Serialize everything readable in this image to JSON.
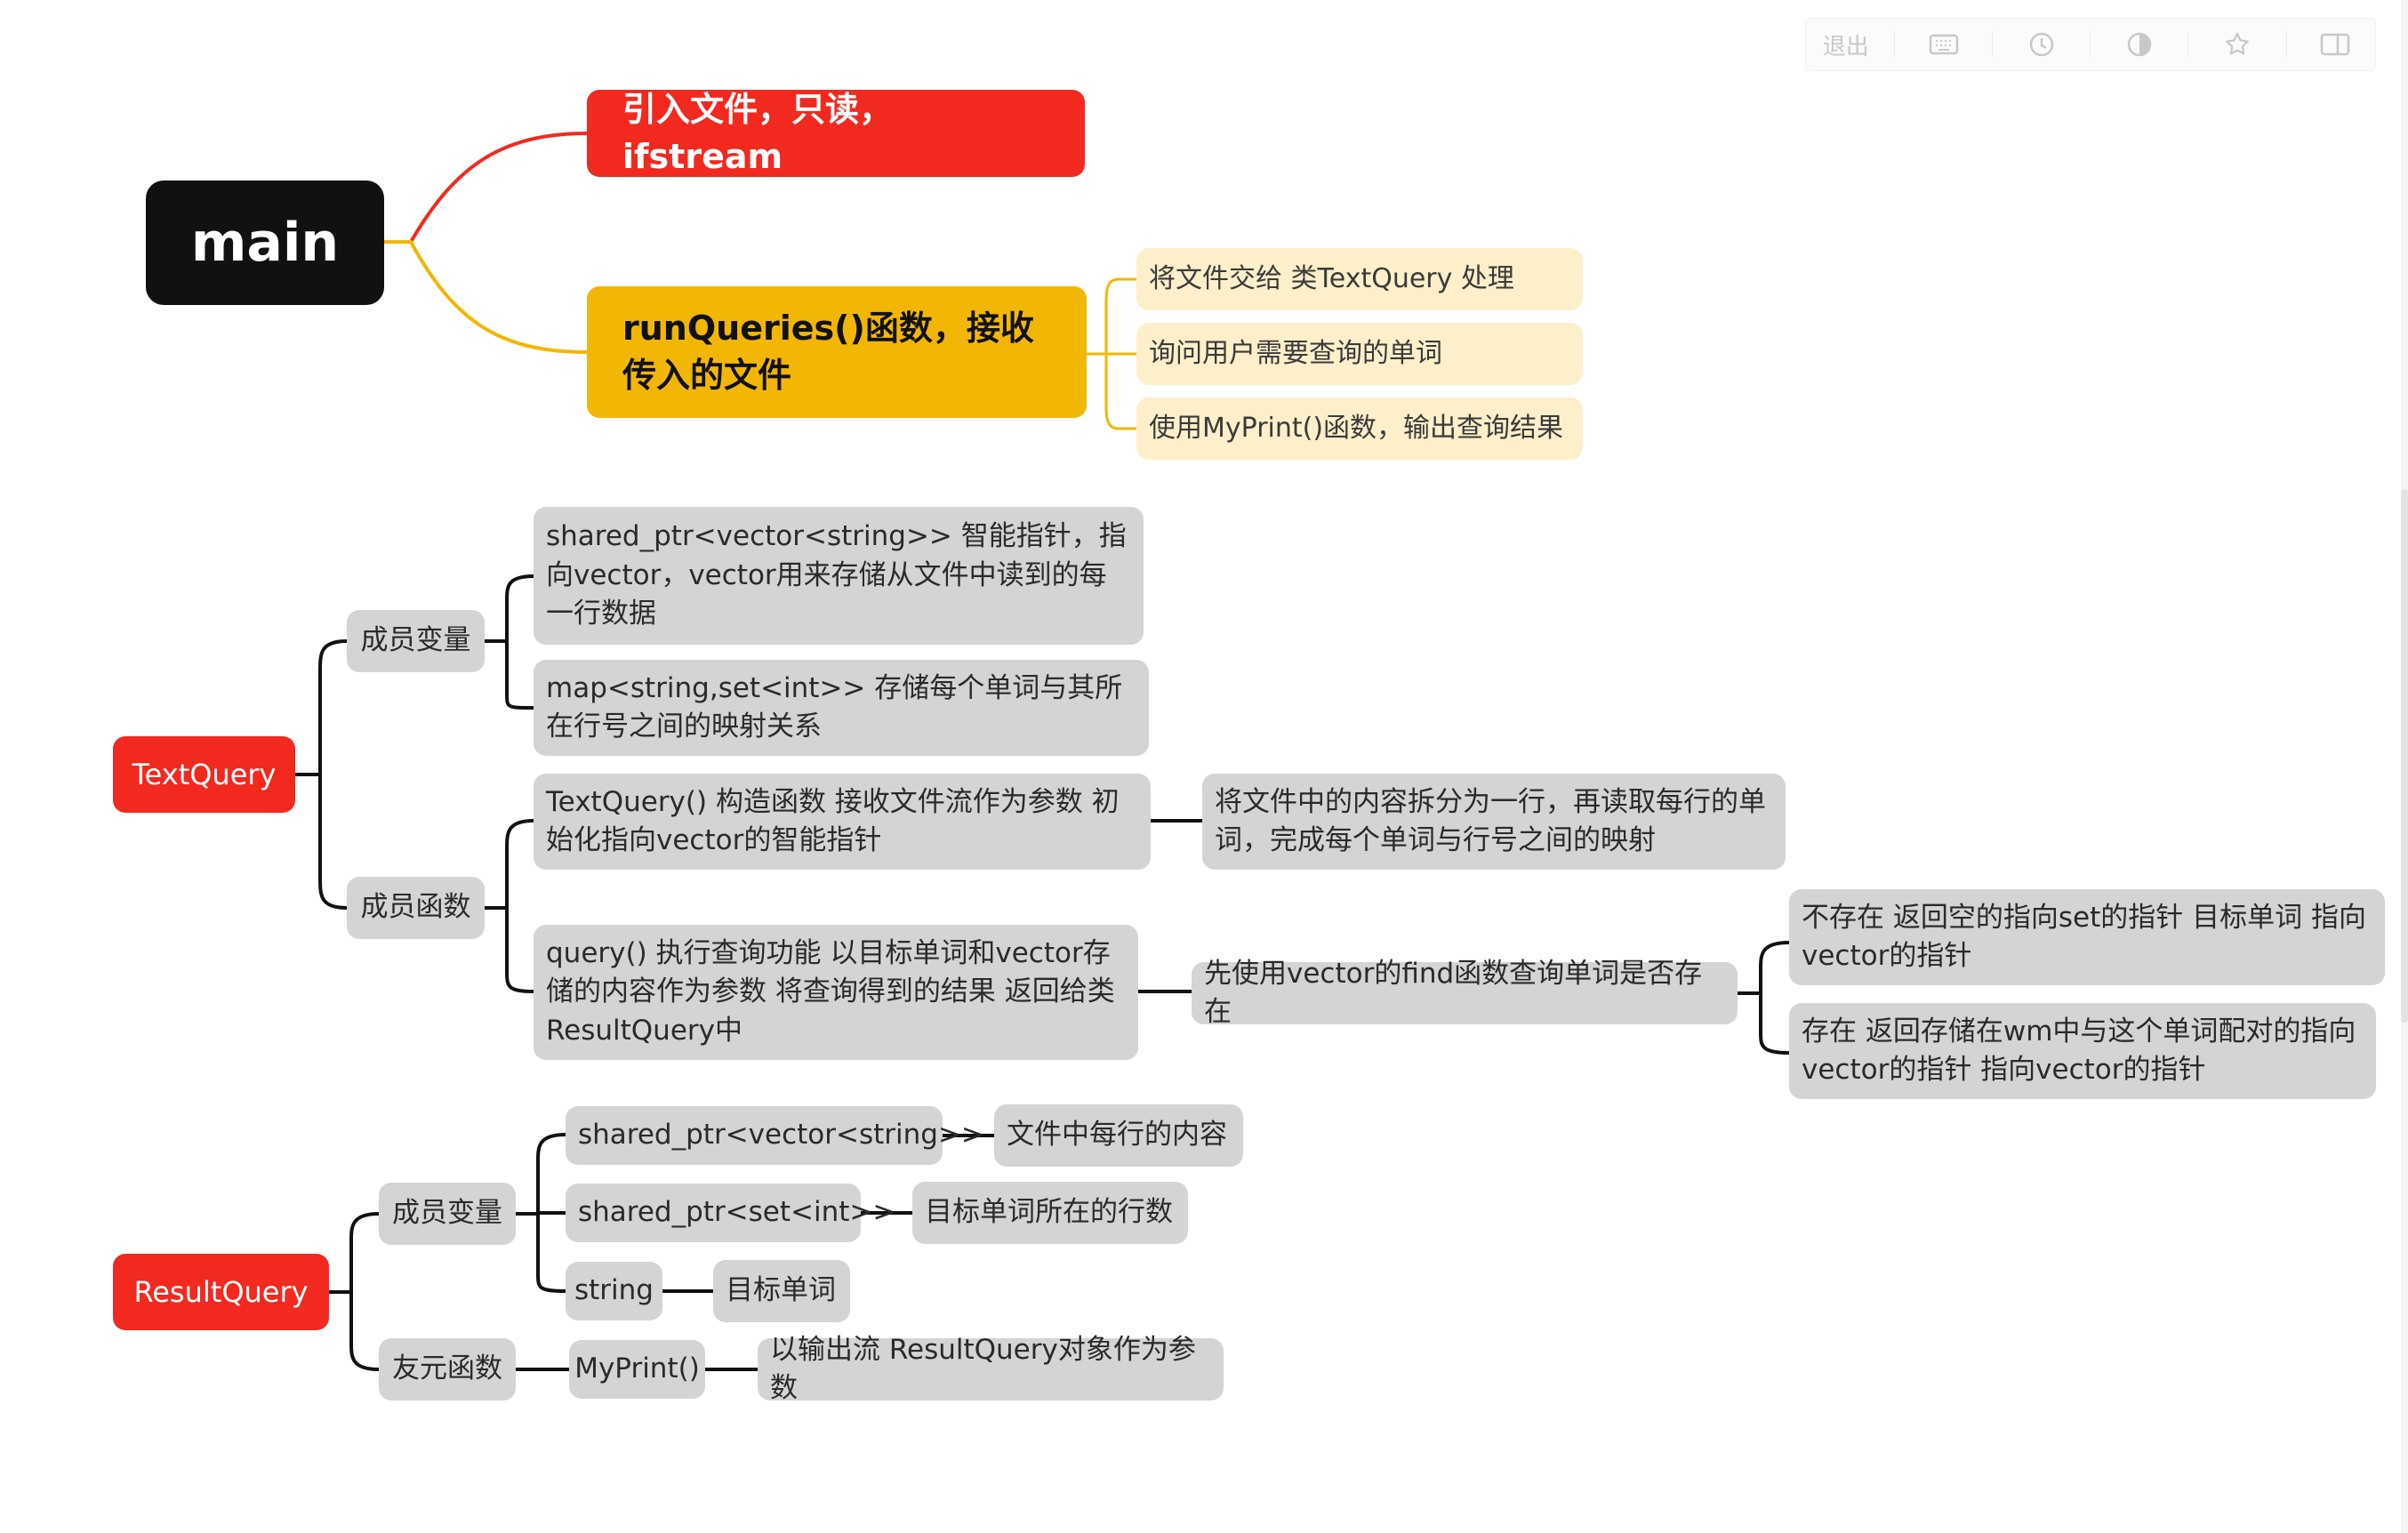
{
  "toolbar": {
    "exit_label": "退出",
    "icons": [
      "keyboard-icon",
      "history-icon",
      "theme-contrast-icon",
      "star-icon",
      "panel-icon"
    ]
  },
  "nodes": {
    "main": "main",
    "import_file": "引入文件，只读，ifstream",
    "run_queries": "runQueries()函数，接收传入的文件",
    "rq_pass_file": "将文件交给  类TextQuery 处理",
    "rq_ask_word": "询问用户需要查询的单词",
    "rq_use_print": "使用MyPrint()函数，输出查询结果",
    "textquery": "TextQuery",
    "tq_members": "成员变量",
    "tq_shared_ptr": "shared_ptr<vector<string>>   智能指针，指向vector，vector用来存储从文件中读到的每一行数据",
    "tq_map": "map<string,set<int>>  存储每个单词与其所在行号之间的映射关系",
    "tq_functions": "成员函数",
    "tq_ctor": "TextQuery() 构造函数 接收文件流作为参数 初始化指向vector的智能指针",
    "tq_ctor_detail": "将文件中的内容拆分为一行，再读取每行的单词，完成每个单词与行号之间的映射",
    "tq_query": "query() 执行查询功能 以目标单词和vector存储的内容作为参数 将查询得到的结果 返回给类ResultQuery中",
    "tq_query_find": "先使用vector的find函数查询单词是否存在",
    "tq_not_exist": "不存在  返回空的指向set的指针 目标单词 指向vector的指针",
    "tq_exist": "存在  返回存储在wm中与这个单词配对的指向vector的指针  指向vector的指针",
    "resultquery": "ResultQuery",
    "rq_members": "成员变量",
    "rq_sp_vec": "shared_ptr<vector<string>>",
    "rq_sp_vec_desc": "文件中每行的内容",
    "rq_sp_set": "shared_ptr<set<int>>",
    "rq_sp_set_desc": "目标单词所在的行数",
    "rq_string": "string",
    "rq_string_desc": "目标单词",
    "rq_friend": "友元函数",
    "rq_myprint": "MyPrint()",
    "rq_myprint_desc": "以输出流 ResultQuery对象作为参数"
  },
  "colors": {
    "red": "#f2291f",
    "yellow": "#f2b705",
    "black": "#111111",
    "cream": "#fcefca",
    "gray": "#d4d4d4"
  }
}
